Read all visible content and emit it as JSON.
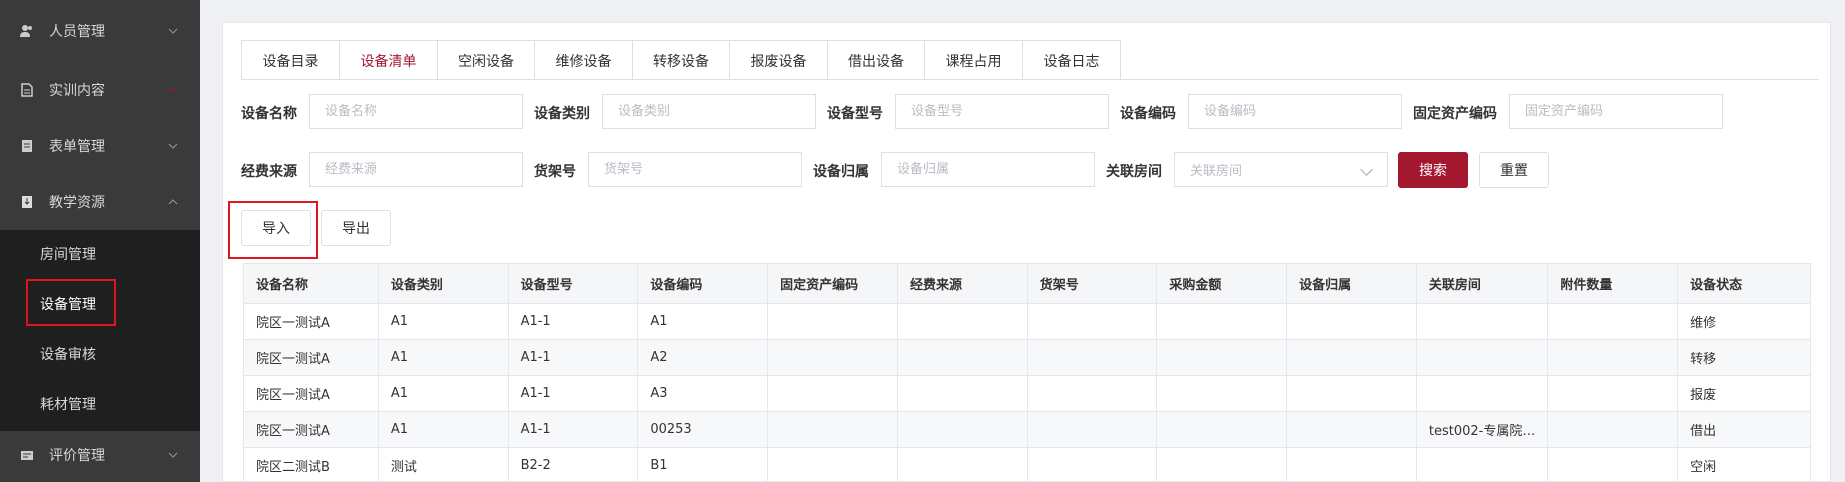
{
  "sidebar": {
    "menus": [
      {
        "label": "人员管理",
        "icon": "user-icon",
        "chevron": "down"
      },
      {
        "label": "实训内容",
        "icon": "document-icon",
        "chevron": "down"
      },
      {
        "label": "表单管理",
        "icon": "form-icon",
        "chevron": "down"
      },
      {
        "label": "教学资源",
        "icon": "book-icon",
        "chevron": "up"
      },
      {
        "label": "评价管理",
        "icon": "rating-icon",
        "chevron": "down"
      }
    ],
    "submenu": [
      "房间管理",
      "设备管理",
      "设备审核",
      "耗材管理"
    ],
    "active_sub": "设备管理"
  },
  "tabs": [
    "设备目录",
    "设备清单",
    "空闲设备",
    "维修设备",
    "转移设备",
    "报废设备",
    "借出设备",
    "课程占用",
    "设备日志"
  ],
  "active_tab": "设备清单",
  "filters": {
    "name": {
      "label": "设备名称",
      "placeholder": "设备名称"
    },
    "category": {
      "label": "设备类别",
      "placeholder": "设备类别"
    },
    "model": {
      "label": "设备型号",
      "placeholder": "设备型号"
    },
    "code": {
      "label": "设备编码",
      "placeholder": "设备编码"
    },
    "asset_code": {
      "label": "固定资产编码",
      "placeholder": "固定资产编码"
    },
    "fund": {
      "label": "经费来源",
      "placeholder": "经费来源"
    },
    "shelf": {
      "label": "货架号",
      "placeholder": "货架号"
    },
    "owner": {
      "label": "设备归属",
      "placeholder": "设备归属"
    },
    "room": {
      "label": "关联房间",
      "placeholder": "关联房间"
    }
  },
  "buttons": {
    "search": "搜索",
    "reset": "重置",
    "import": "导入",
    "export": "导出"
  },
  "table": {
    "headers": [
      "设备名称",
      "设备类别",
      "设备型号",
      "设备编码",
      "固定资产编码",
      "经费来源",
      "货架号",
      "采购金额",
      "设备归属",
      "关联房间",
      "附件数量",
      "设备状态"
    ],
    "rows": [
      [
        "院区一测试A",
        "A1",
        "A1-1",
        "A1",
        "",
        "",
        "",
        "",
        "",
        "",
        "",
        "维修"
      ],
      [
        "院区一测试A",
        "A1",
        "A1-1",
        "A2",
        "",
        "",
        "",
        "",
        "",
        "",
        "",
        "转移"
      ],
      [
        "院区一测试A",
        "A1",
        "A1-1",
        "A3",
        "",
        "",
        "",
        "",
        "",
        "",
        "",
        "报废"
      ],
      [
        "院区一测试A",
        "A1",
        "A1-1",
        "00253",
        "",
        "",
        "",
        "",
        "",
        "test002-专属院…",
        "",
        "借出"
      ],
      [
        "院区二测试B",
        "测试",
        "B2-2",
        "B1",
        "",
        "",
        "",
        "",
        "",
        "",
        "",
        "空闲"
      ]
    ]
  },
  "colors": {
    "sidebar": "#3a3a3a",
    "submenu": "#1f1f1f",
    "accent": "#a3182f",
    "highlight": "#e0141c"
  }
}
